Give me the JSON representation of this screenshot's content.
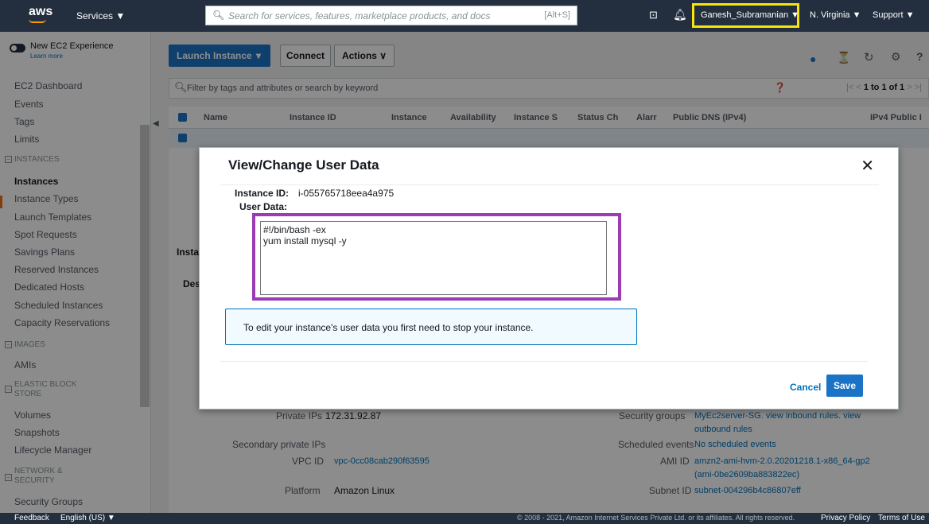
{
  "topnav": {
    "logo": "aws",
    "services": "Services ▼",
    "search_placeholder": "Search for services, features, marketplace products, and docs",
    "search_shortcut": "[Alt+S]",
    "user": "Ganesh_Subramanian ▼",
    "region": "N. Virginia ▼",
    "support": "Support ▼"
  },
  "sidebar": {
    "new_experience": "New EC2 Experience",
    "learn_more": "Learn more",
    "dashboard": "EC2 Dashboard",
    "events": "Events",
    "tags": "Tags",
    "limits": "Limits",
    "section_instances": "INSTANCES",
    "instances": "Instances",
    "instance_types": "Instance Types",
    "launch_templates": "Launch Templates",
    "spot_requests": "Spot Requests",
    "savings_plans": "Savings Plans",
    "reserved_instances": "Reserved Instances",
    "dedicated_hosts": "Dedicated Hosts",
    "scheduled_instances": "Scheduled Instances",
    "capacity_reservations": "Capacity Reservations",
    "section_images": "IMAGES",
    "amis": "AMIs",
    "section_ebs": "ELASTIC BLOCK STORE",
    "volumes": "Volumes",
    "snapshots": "Snapshots",
    "lifecycle_manager": "Lifecycle Manager",
    "section_network": "NETWORK & SECURITY",
    "security_groups": "Security Groups"
  },
  "toolbar": {
    "launch_instance": "Launch Instance",
    "connect": "Connect",
    "actions": "Actions ∨"
  },
  "filter": {
    "placeholder": "Filter by tags and attributes or search by keyword",
    "pager": "1 to 1 of 1"
  },
  "table": {
    "columns": [
      "Name",
      "Instance ID",
      "Instance",
      "Availability",
      "Instance S",
      "Status Ch",
      "Alarr",
      "Public DNS (IPv4)",
      "IPv4 Public I"
    ]
  },
  "details": {
    "tab_partial": "Des",
    "header_partial": "Insta",
    "private_ips_label": "Private IPs",
    "private_ips_value": "172.31.92.87",
    "secondary_ips_label": "Secondary private IPs",
    "vpc_label": "VPC ID",
    "vpc_value": "vpc-0cc08cab290f63595",
    "platform_label": "Platform",
    "platform_value": "Amazon Linux",
    "sg_label": "Security groups",
    "sg_value": "MyEc2server-SG. view inbound rules. view outbound rules",
    "sched_label": "Scheduled events",
    "sched_value": "No scheduled events",
    "ami_label": "AMI ID",
    "ami_value": "amzn2-ami-hvm-2.0.20201218.1-x86_64-gp2 (ami-0be2609ba883822ec)",
    "subnet_label": "Subnet ID",
    "subnet_value": "subnet-004296b4c86807eff"
  },
  "modal": {
    "title": "View/Change User Data",
    "instance_id_label": "Instance ID:",
    "instance_id_value": "i-055765718eea4a975",
    "user_data_label": "User Data:",
    "user_data_value": "#!/bin/bash -ex\nyum install mysql -y",
    "info_text": "To edit your instance's user data you first need to stop your instance.",
    "cancel": "Cancel",
    "save": "Save"
  },
  "footer": {
    "feedback": "Feedback",
    "language": "English (US) ▼",
    "copyright": "© 2008 - 2021, Amazon Internet Services Private Ltd. or its affiliates. All rights reserved.",
    "privacy": "Privacy Policy",
    "terms": "Terms of Use"
  },
  "colors": {
    "nav": "#232f3e",
    "primary": "#1a73c6",
    "accent": "#ff9900",
    "highlight_yellow": "#f5e50a",
    "highlight_purple": "#9b3cb4"
  }
}
